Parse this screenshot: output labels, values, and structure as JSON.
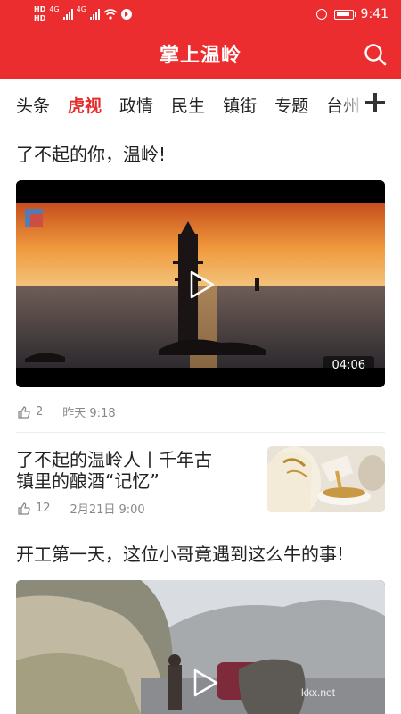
{
  "status_bar": {
    "hd1": "HD",
    "hd2": "HD",
    "net1": "4G",
    "net2": "4G",
    "time": "9:41"
  },
  "app_bar": {
    "title": "掌上温岭"
  },
  "tabs": [
    {
      "label": "头条",
      "active": false
    },
    {
      "label": "虎视",
      "active": true
    },
    {
      "label": "政情",
      "active": false
    },
    {
      "label": "民生",
      "active": false
    },
    {
      "label": "镇街",
      "active": false
    },
    {
      "label": "专题",
      "active": false
    },
    {
      "label": "台州",
      "active": false
    }
  ],
  "articles": [
    {
      "title": "了不起的你，温岭!",
      "duration": "04:06",
      "likes": "2",
      "time": "昨天 9:18"
    },
    {
      "title_line1": "了不起的温岭人丨千年古",
      "title_line2": "镇里的酿酒“记忆”",
      "likes": "12",
      "time": "2月21日 9:00"
    },
    {
      "title": "开工第一天，这位小哥竟遇到这么牛的事!"
    }
  ],
  "watermark": "kkx.net"
}
